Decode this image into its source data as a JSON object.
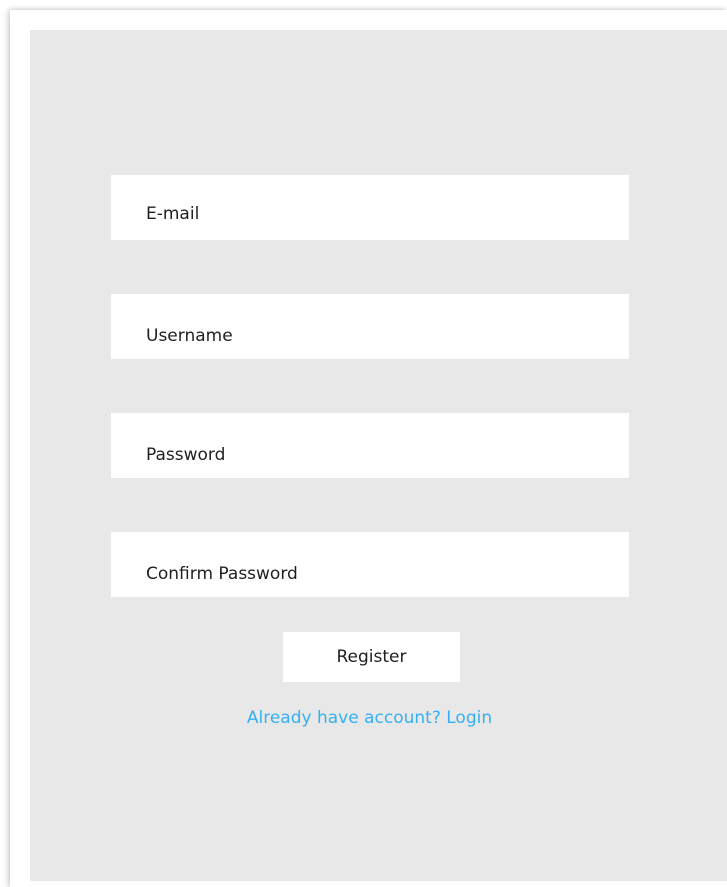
{
  "form": {
    "fields": [
      {
        "name": "email",
        "placeholder": "E-mail",
        "value": ""
      },
      {
        "name": "username",
        "placeholder": "Username",
        "value": ""
      },
      {
        "name": "password",
        "placeholder": "Password",
        "value": ""
      },
      {
        "name": "confirm_password",
        "placeholder": "Confirm Password",
        "value": ""
      }
    ],
    "register_label": "Register",
    "login_link_label": "Already have account? Login"
  },
  "colors": {
    "panel_background": "#e8e8e8",
    "field_background": "#ffffff",
    "link": "#35b0f2",
    "text": "#1f1f1f"
  }
}
